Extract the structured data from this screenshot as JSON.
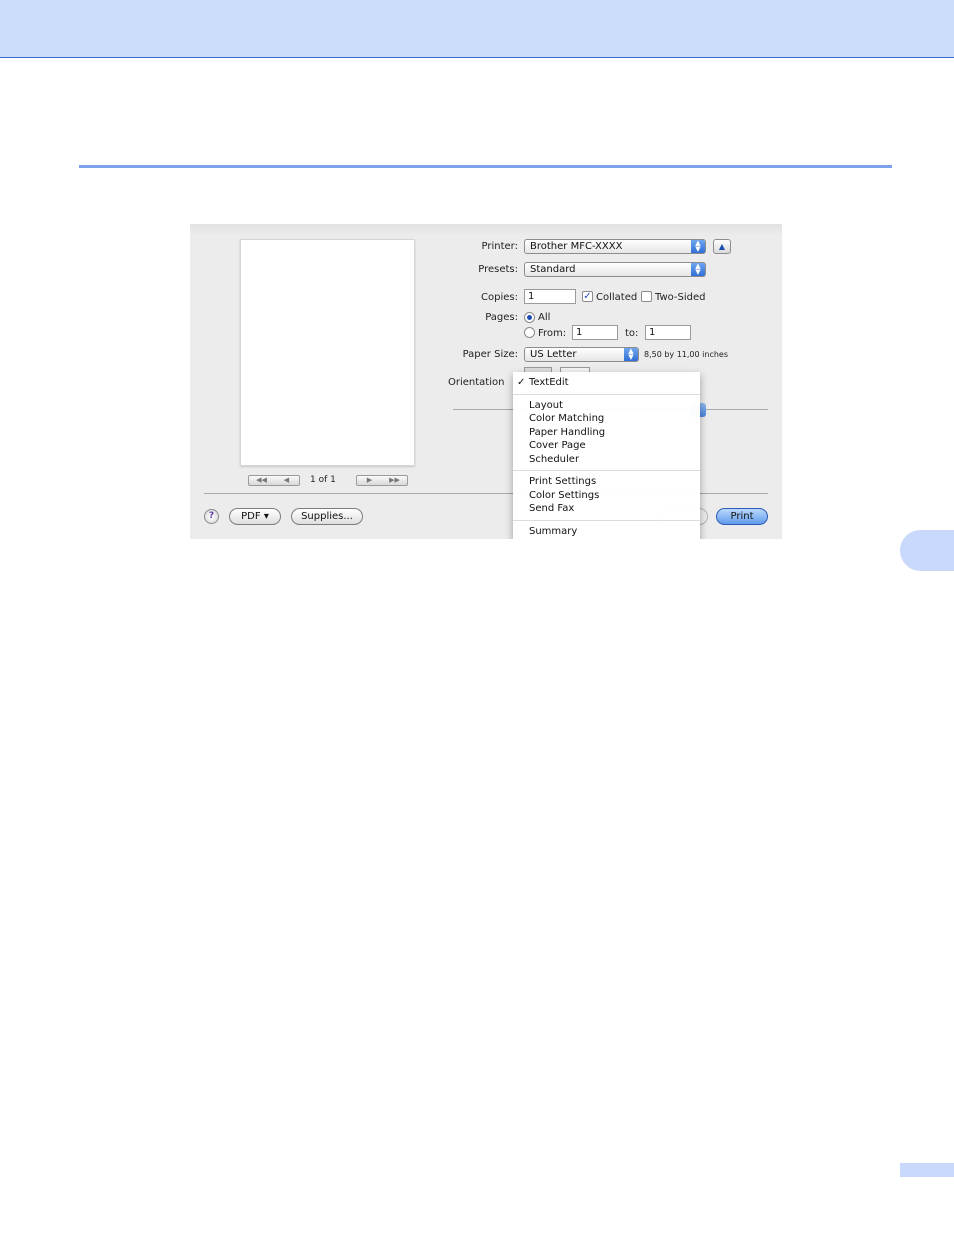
{
  "dialog": {
    "printer_label": "Printer:",
    "printer_value": "Brother MFC-XXXX",
    "presets_label": "Presets:",
    "presets_value": "Standard",
    "copies_label": "Copies:",
    "copies_value": "1",
    "collated_label": "Collated",
    "collated_checked": true,
    "two_sided_label": "Two-Sided",
    "two_sided_checked": false,
    "pages_label": "Pages:",
    "pages_all_label": "All",
    "pages_from_label": "From:",
    "pages_from_value": "1",
    "pages_to_label": "to:",
    "pages_to_value": "1",
    "paper_size_label": "Paper Size:",
    "paper_size_value": "US Letter",
    "paper_size_dims": "8,50 by 11,00 inches",
    "orientation_label": "Orientation",
    "page_indicator": "1 of 1",
    "pdf_button": "PDF ▾",
    "supplies_button": "Supplies...",
    "help_button": "?",
    "print_button": "Print"
  },
  "menu": {
    "check_mark": "✓",
    "items": [
      "TextEdit",
      "Layout",
      "Color Matching",
      "Paper Handling",
      "Cover Page",
      "Scheduler",
      "Print Settings",
      "Color Settings",
      "Send Fax",
      "Summary"
    ],
    "selected": "TextEdit"
  },
  "colors": {
    "band": "#ccdcfb",
    "rule": "#7ea1ee",
    "accent": "#2f6fd6"
  },
  "icons": [
    "popup-arrows-icon",
    "disclosure-triangle-icon",
    "first-page-icon",
    "prev-page-icon",
    "next-page-icon",
    "last-page-icon",
    "checkmark-icon",
    "help-icon"
  ]
}
